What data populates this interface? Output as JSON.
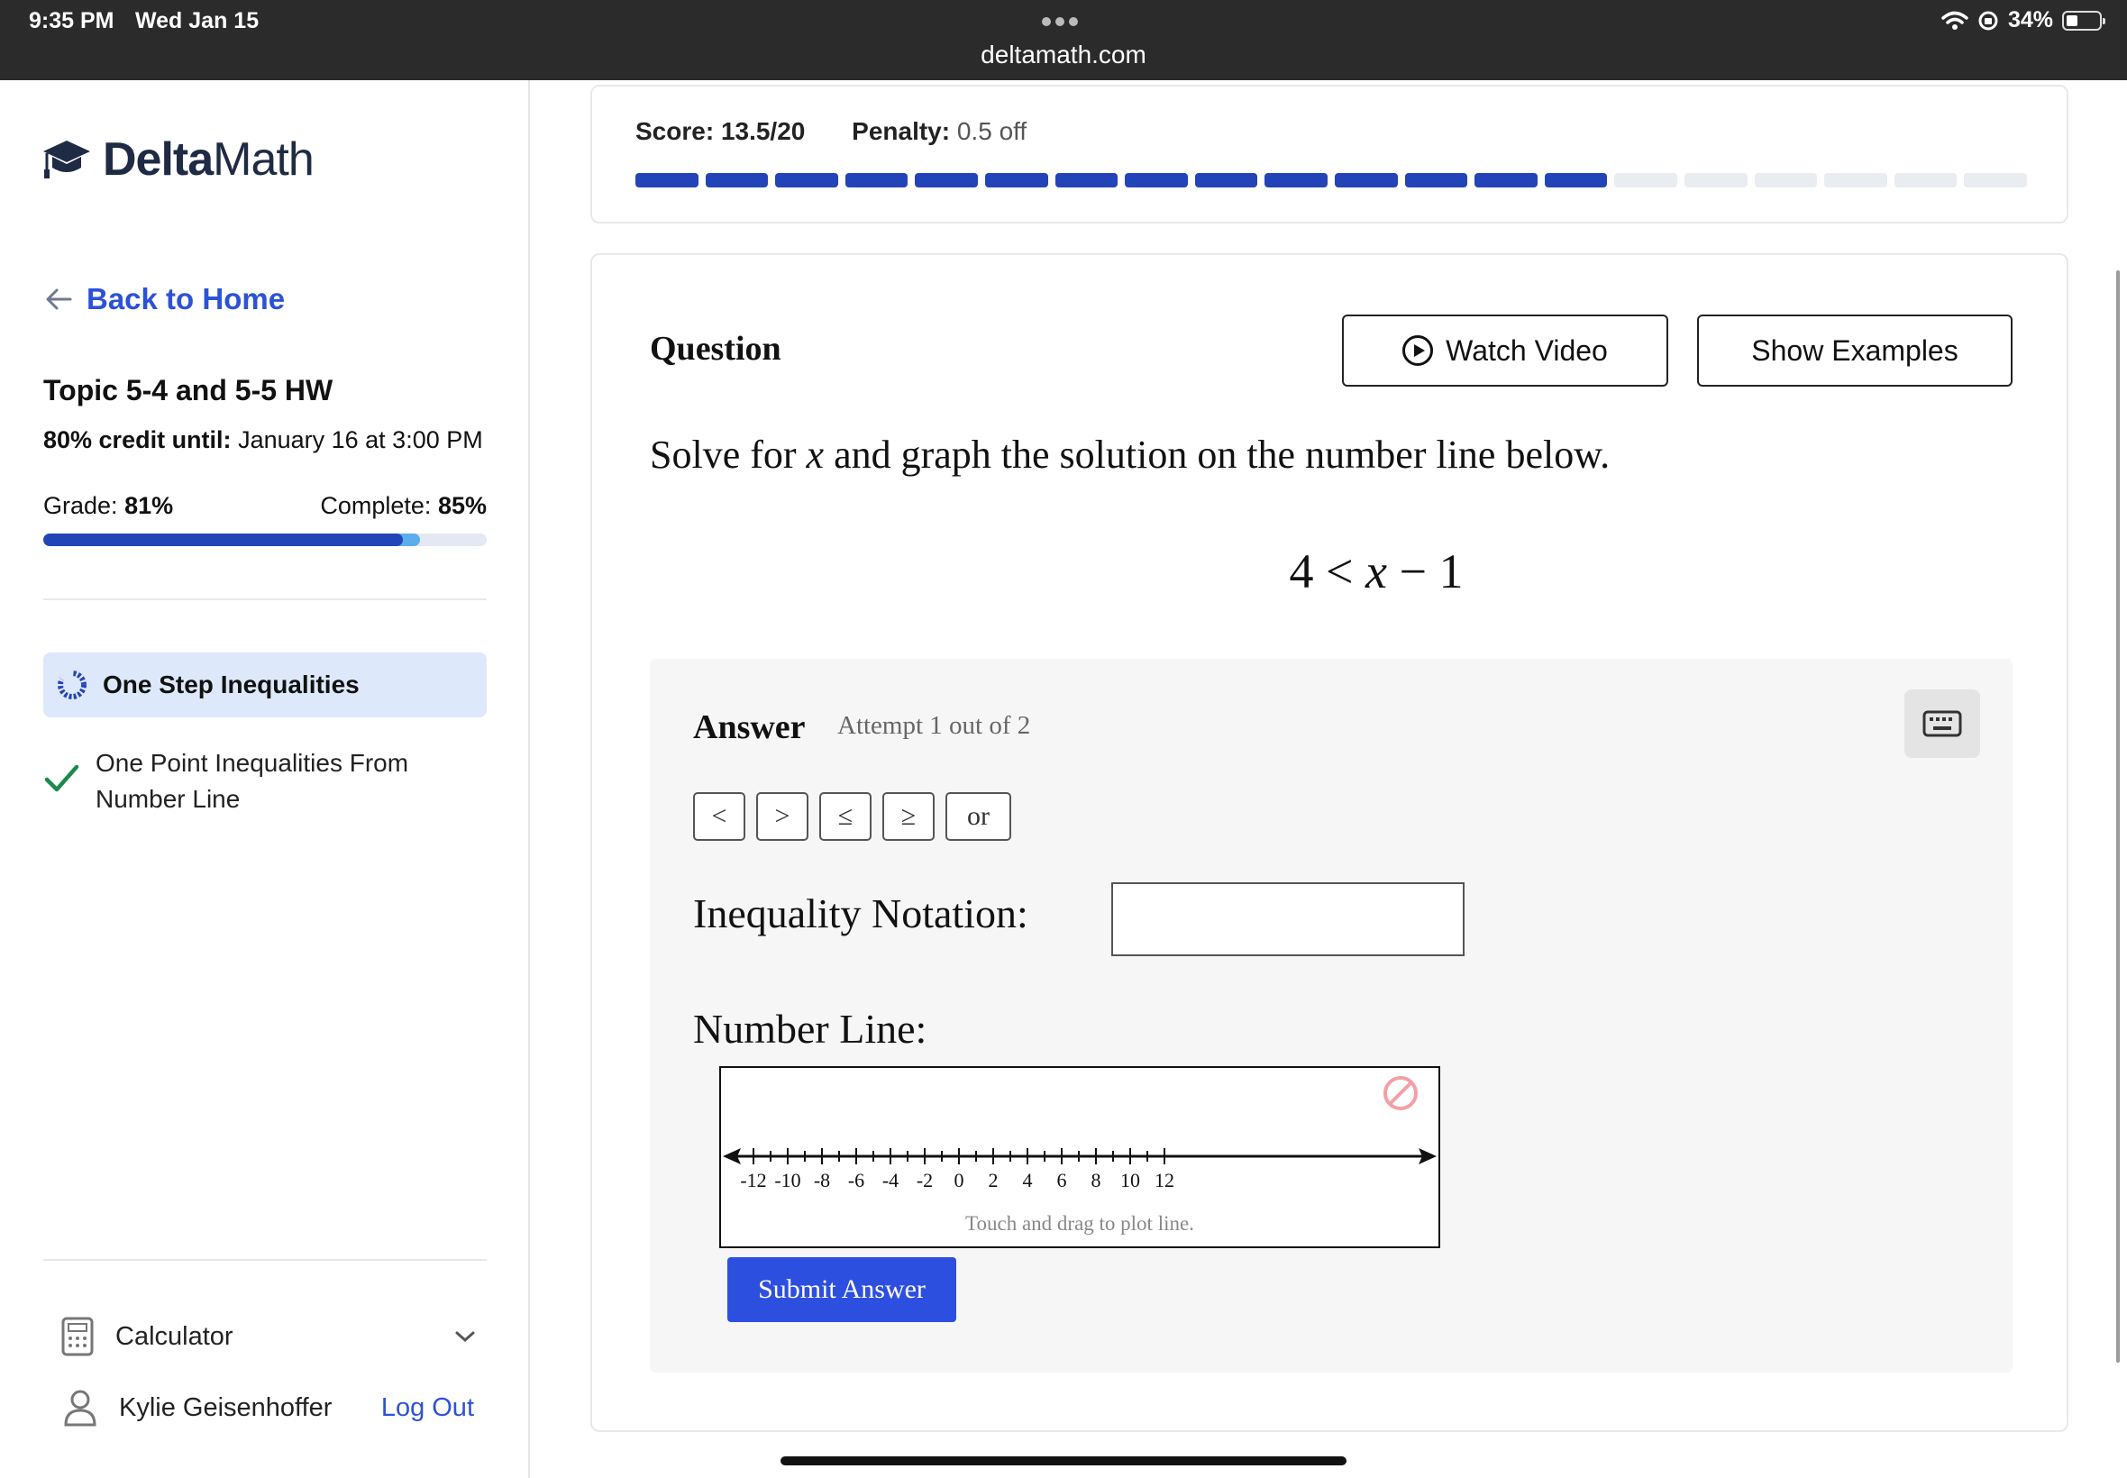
{
  "status_bar": {
    "time": "9:35 PM",
    "date": "Wed Jan 15",
    "url": "deltamath.com",
    "battery": "34%",
    "battery_level": 0.34
  },
  "sidebar": {
    "logo_text_bold": "Delta",
    "logo_text_light": "Math",
    "back_label": "Back to Home",
    "assignment_title": "Topic 5-4 and 5-5 HW",
    "credit_label": "80% credit until:",
    "credit_value": "January 16 at 3:00 PM",
    "grade_label": "Grade:",
    "grade_value": "81%",
    "complete_label": "Complete:",
    "complete_value": "85%",
    "grade_fraction": 0.81,
    "complete_fraction": 0.85,
    "skills": [
      {
        "label": "One Step Inequalities",
        "state": "active"
      },
      {
        "label": "One Point Inequalities From Number Line",
        "state": "completed"
      }
    ],
    "calculator_label": "Calculator",
    "user_name": "Kylie Geisenhoffer",
    "logout_label": "Log Out"
  },
  "score": {
    "score_label": "Score:",
    "score_value": "13.5/20",
    "penalty_label": "Penalty:",
    "penalty_value": "0.5 off",
    "segments_total": 20,
    "segments_filled": 14,
    "accent_color": "#2343b8"
  },
  "question": {
    "title": "Question",
    "watch_video_label": "Watch Video",
    "show_examples_label": "Show Examples",
    "prompt_before": "Solve for ",
    "prompt_var": "x",
    "prompt_after": " and graph the solution on the number line below.",
    "expr_left": "4 <",
    "expr_var": "x",
    "expr_right": "− 1"
  },
  "answer": {
    "title": "Answer",
    "attempt": "Attempt 1 out of 2",
    "symbols": [
      "<",
      ">",
      "≤",
      "≥",
      "or"
    ],
    "inequality_label": "Inequality Notation:",
    "inequality_value": "",
    "number_line_label": "Number Line:",
    "number_line_ticks": [
      "-12",
      "-10",
      "-8",
      "-6",
      "-4",
      "-2",
      "0",
      "2",
      "4",
      "6",
      "8",
      "10",
      "12"
    ],
    "number_line_hint": "Touch and drag to plot line.",
    "submit_label": "Submit Answer",
    "submit_color": "#2d4fe0"
  }
}
